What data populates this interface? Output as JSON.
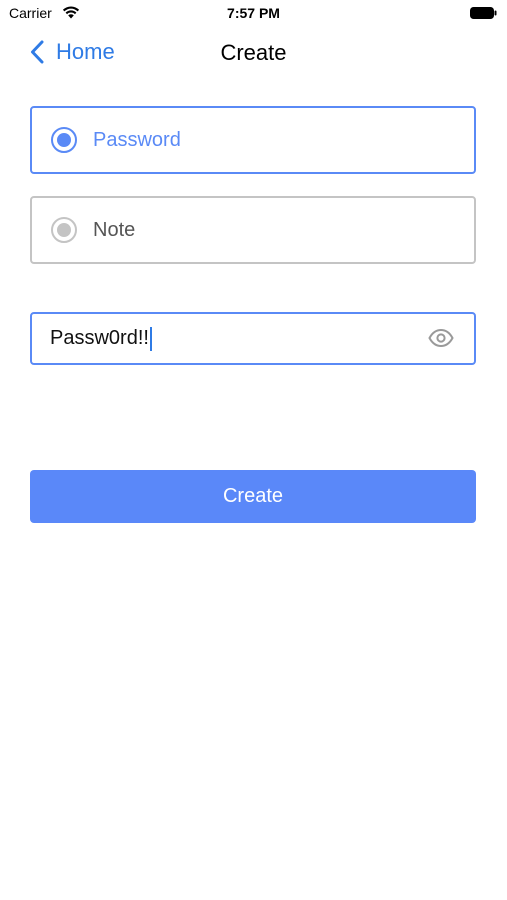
{
  "status_bar": {
    "carrier": "Carrier",
    "time": "7:57 PM",
    "icons": [
      "wifi-icon",
      "battery-icon"
    ]
  },
  "nav": {
    "back_label": "Home",
    "back_icon": "chevron-left-icon",
    "title": "Create"
  },
  "options": [
    {
      "label": "Password",
      "selected": true
    },
    {
      "label": "Note",
      "selected": false
    }
  ],
  "password_field": {
    "value": "Passw0rd!!",
    "toggle_icon": "eye-icon"
  },
  "create_button": {
    "label": "Create"
  },
  "colors": {
    "accent": "#5a8af6",
    "link": "#2f7be5",
    "button_bg": "#5a88f9",
    "unselected_border": "#c4c4c4"
  }
}
